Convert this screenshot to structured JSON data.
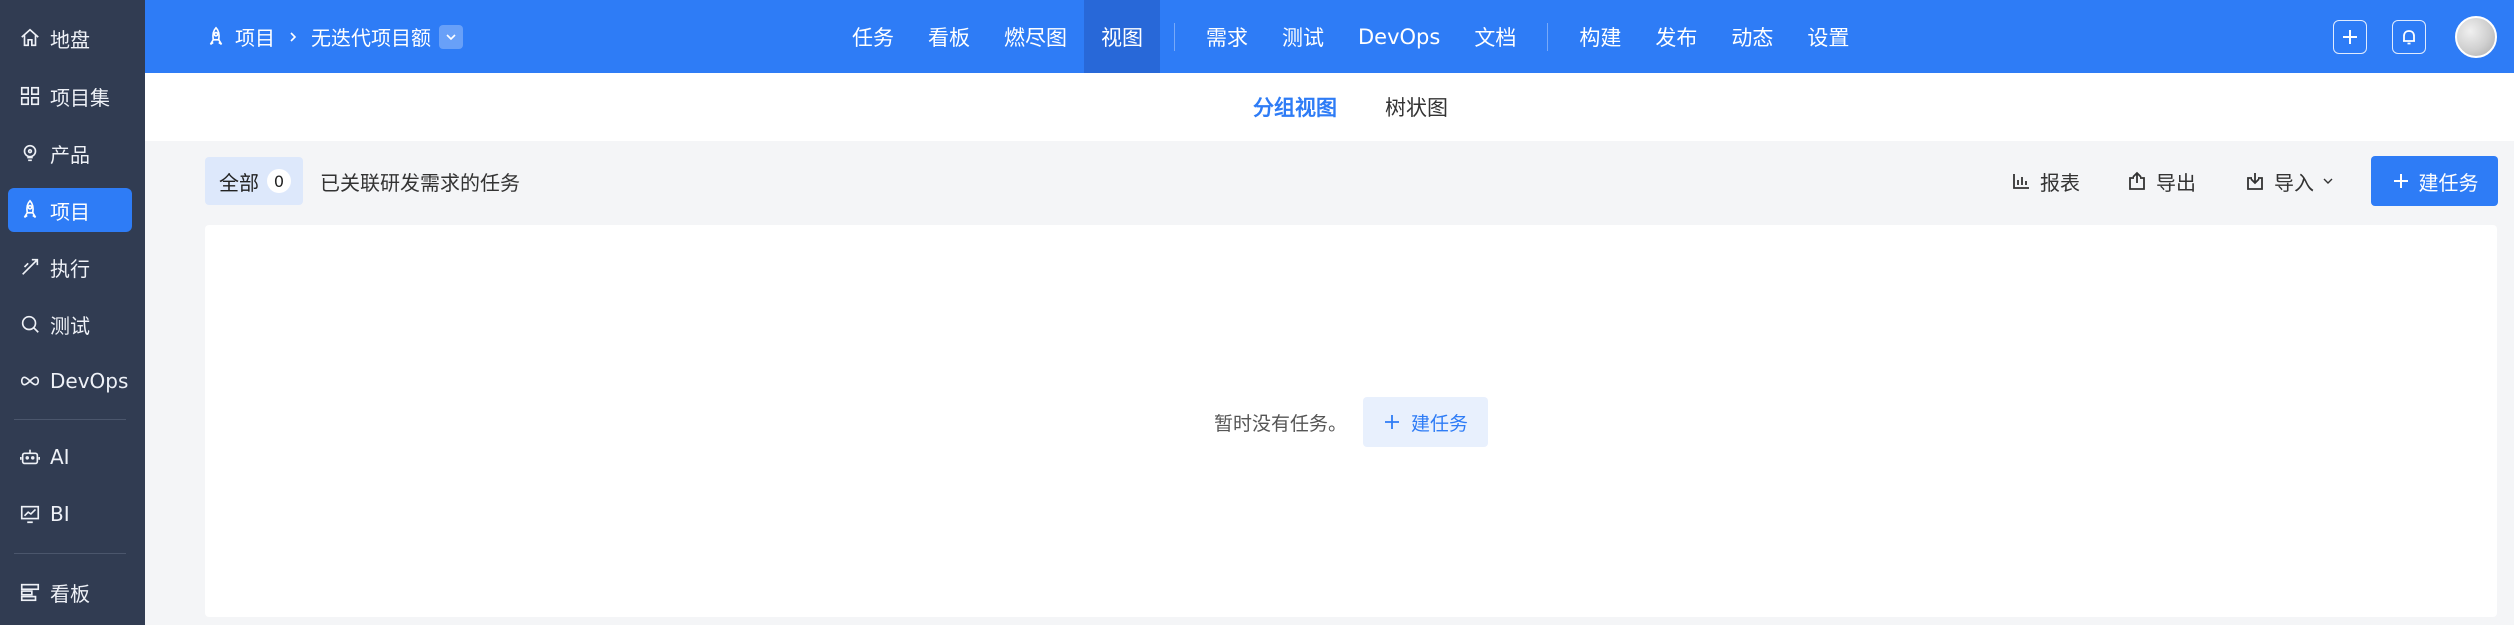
{
  "sidebar": {
    "items": [
      {
        "label": "地盘",
        "icon": "home-icon"
      },
      {
        "label": "项目集",
        "icon": "grid-icon"
      },
      {
        "label": "产品",
        "icon": "bulb-icon"
      },
      {
        "label": "项目",
        "icon": "rocket-icon"
      },
      {
        "label": "执行",
        "icon": "run-icon"
      },
      {
        "label": "测试",
        "icon": "search-icon"
      },
      {
        "label": "DevOps",
        "icon": "infinity-icon"
      },
      {
        "label": "AI",
        "icon": "robot-icon"
      },
      {
        "label": "BI",
        "icon": "chart-board-icon"
      },
      {
        "label": "看板",
        "icon": "kanban-icon"
      }
    ],
    "active_label": "项目"
  },
  "header": {
    "breadcrumb": {
      "root": "项目",
      "current": "无迭代项目额"
    },
    "nav": [
      "任务",
      "看板",
      "燃尽图",
      "视图",
      "需求",
      "测试",
      "DevOps",
      "文档",
      "构建",
      "发布",
      "动态",
      "设置"
    ],
    "active_nav": "视图"
  },
  "subtabs": {
    "group_view": "分组视图",
    "tree_view": "树状图",
    "active": "分组视图"
  },
  "toolbar": {
    "filter_all": "全部",
    "filter_count": "0",
    "filter_desc": "已关联研发需求的任务",
    "report": "报表",
    "export": "导出",
    "import": "导入",
    "create_task": "建任务"
  },
  "empty_state": {
    "message": "暂时没有任务。",
    "create_button": "建任务"
  },
  "colors": {
    "primary": "#2e7cf6",
    "sidebar_bg": "#313c52"
  }
}
